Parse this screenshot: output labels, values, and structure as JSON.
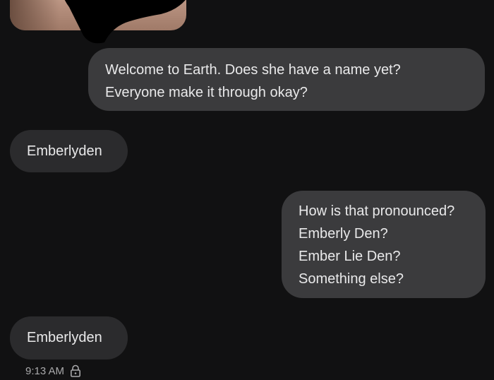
{
  "conversation": {
    "messages": [
      {
        "direction": "outgoing",
        "lines": [
          "Welcome to Earth. Does she have a name yet?",
          "Everyone make it through okay?"
        ]
      },
      {
        "direction": "incoming",
        "lines": [
          "Emberlyden"
        ]
      },
      {
        "direction": "outgoing",
        "lines": [
          "How is that pronounced?",
          "Emberly Den?",
          "Ember Lie Den?",
          "Something else?"
        ]
      },
      {
        "direction": "incoming",
        "lines": [
          "Emberlyden"
        ]
      }
    ],
    "last_timestamp": "9:13 AM",
    "status_icon": "lock-icon"
  },
  "colors": {
    "background": "#111112",
    "outgoing_bubble": "#3b3b3d",
    "incoming_bubble": "#2b2b2d",
    "text": "#e9e9ea",
    "meta_text": "#a9a9ab"
  }
}
